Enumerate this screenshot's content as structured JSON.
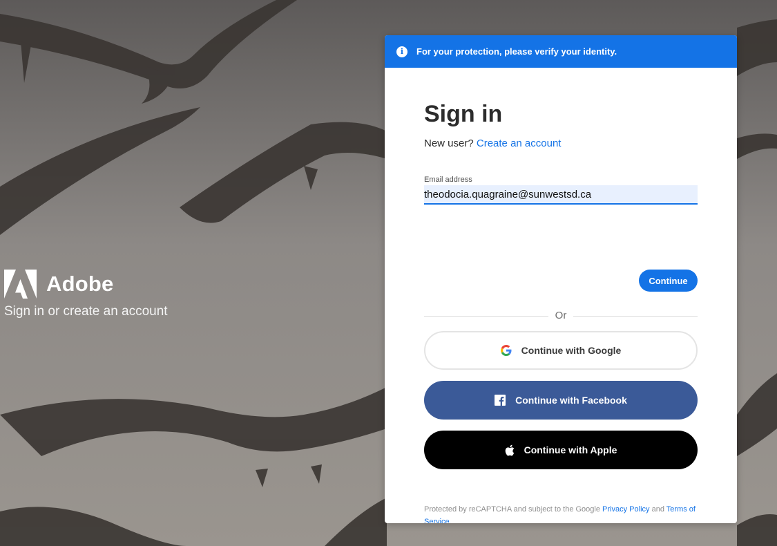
{
  "colors": {
    "accent": "#1473e6",
    "facebook": "#3b5a98",
    "apple": "#000000",
    "input_bg": "#e8f0fe"
  },
  "brand": {
    "name": "Adobe",
    "tagline": "Sign in or create an account",
    "logo_icon": "adobe-logo-icon"
  },
  "notice": {
    "icon": "info-icon",
    "icon_glyph": "i",
    "text": "For your protection, please verify your identity."
  },
  "signin": {
    "title": "Sign in",
    "new_user_prefix": "New user?",
    "create_account_link": "Create an account",
    "email_label": "Email address",
    "email_value": "theodocia.quagraine@sunwestsd.ca",
    "continue_label": "Continue",
    "divider_text": "Or"
  },
  "social": {
    "google_label": "Continue with Google",
    "google_icon": "google-icon",
    "facebook_label": "Continue with Facebook",
    "facebook_icon": "facebook-icon",
    "apple_label": "Continue with Apple",
    "apple_icon": "apple-icon"
  },
  "legal": {
    "prefix": "Protected by reCAPTCHA and subject to the Google",
    "privacy_link": "Privacy Policy",
    "and": "and",
    "terms_link": "Terms of Service",
    "suffix": "."
  }
}
